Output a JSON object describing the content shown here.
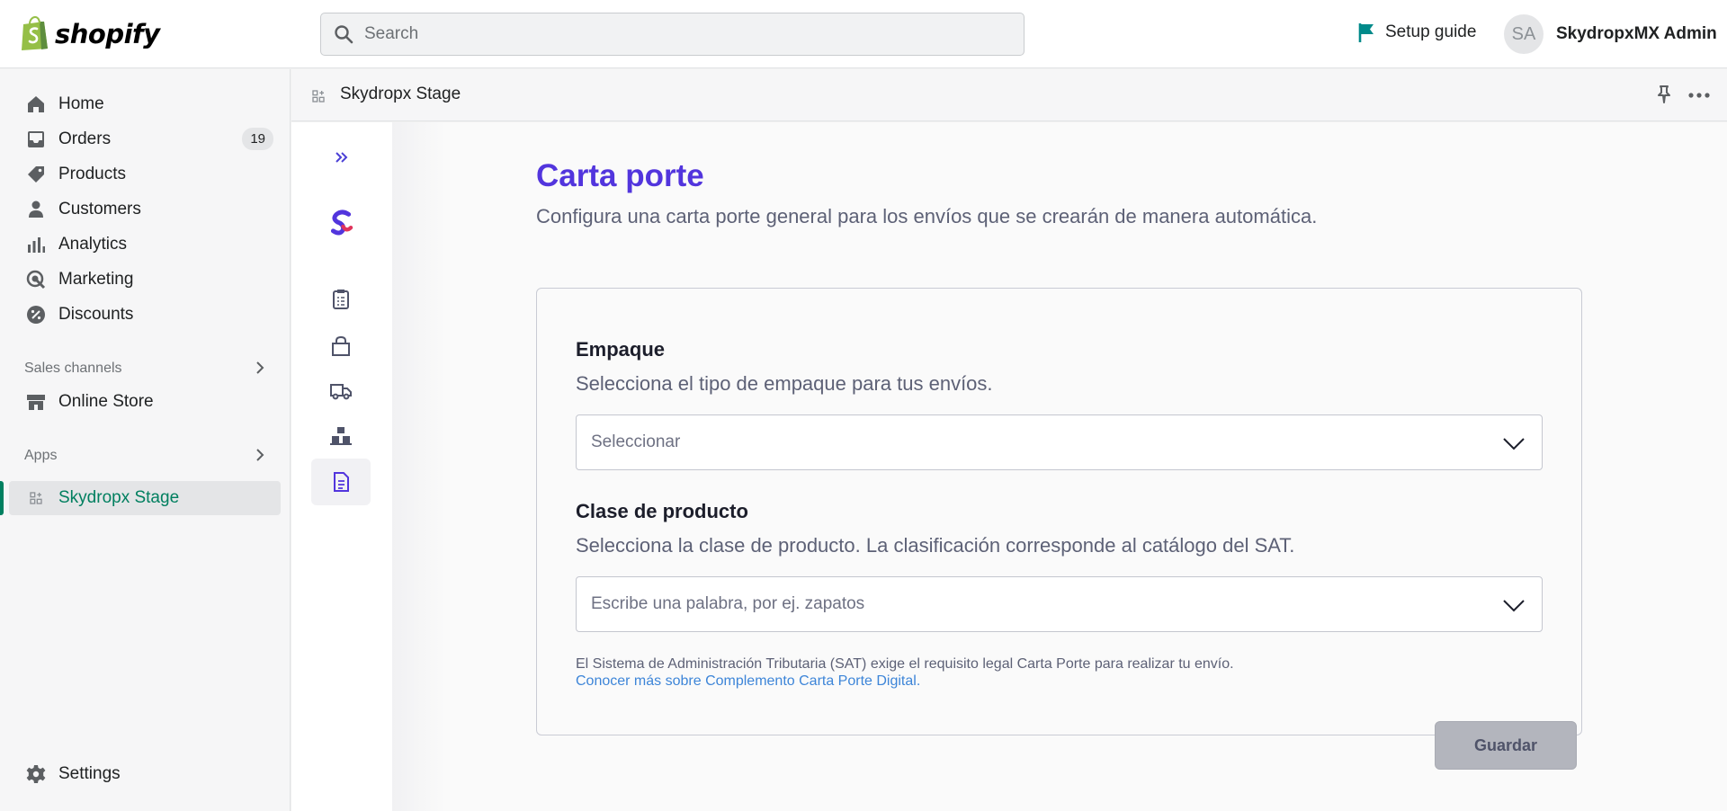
{
  "brand": {
    "name": "shopify"
  },
  "search": {
    "placeholder": "Search"
  },
  "header": {
    "setup_guide": "Setup guide",
    "avatar_initials": "SA",
    "user_name": "SkydropxMX Admin"
  },
  "sidebar": {
    "items": [
      {
        "label": "Home",
        "icon": "home-icon"
      },
      {
        "label": "Orders",
        "icon": "orders-icon",
        "badge": "19"
      },
      {
        "label": "Products",
        "icon": "tag-icon"
      },
      {
        "label": "Customers",
        "icon": "person-icon"
      },
      {
        "label": "Analytics",
        "icon": "bar-chart-icon"
      },
      {
        "label": "Marketing",
        "icon": "target-icon"
      },
      {
        "label": "Discounts",
        "icon": "discount-icon"
      }
    ],
    "sales_channels_title": "Sales channels",
    "online_store": "Online Store",
    "apps_title": "Apps",
    "active_app": "Skydropx Stage",
    "settings": "Settings"
  },
  "app_header": {
    "title": "Skydropx Stage"
  },
  "page": {
    "title": "Carta porte",
    "subtitle": "Configura una carta porte general para los envíos que se crearán de manera automática."
  },
  "form": {
    "packaging_label": "Empaque",
    "packaging_help": "Selecciona el tipo de empaque para tus envíos.",
    "packaging_value": "Seleccionar",
    "product_class_label": "Clase de producto",
    "product_class_help": "Selecciona la clase de producto. La clasificación corresponde al catálogo del SAT.",
    "product_class_placeholder": "Escribe una palabra, por ej. zapatos",
    "note": "El Sistema de Administración Tributaria (SAT) exige el requisito legal Carta Porte para realizar tu envío.",
    "link": "Conocer más sobre Complemento Carta Porte Digital.",
    "save_label": "Guardar"
  },
  "colors": {
    "accent": "#5235dd",
    "shopify_green": "#008060",
    "link": "#3d85d8"
  }
}
